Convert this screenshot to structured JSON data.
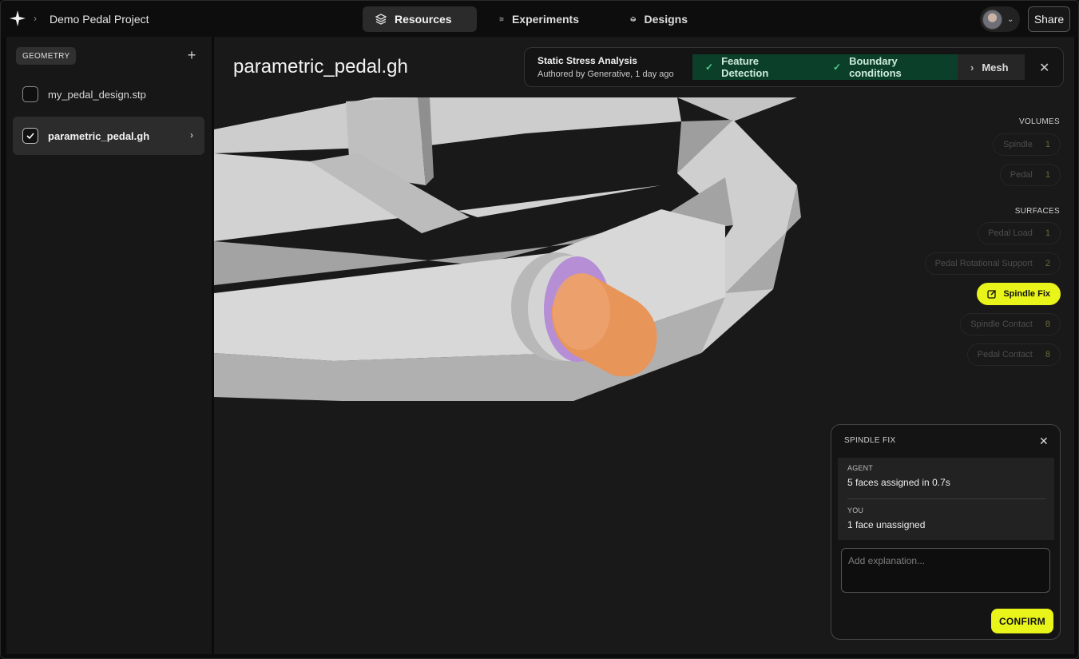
{
  "topbar": {
    "project_name": "Demo Pedal Project",
    "tabs": [
      {
        "label": "Resources",
        "icon": "layers-icon",
        "active": true
      },
      {
        "label": "Experiments",
        "icon": "sliders-icon",
        "active": false
      },
      {
        "label": "Designs",
        "icon": "cube-icon",
        "active": false
      }
    ],
    "share_label": "Share"
  },
  "sidebar": {
    "section_label": "GEOMETRY",
    "files": [
      {
        "name": "my_pedal_design.stp",
        "checked": false
      },
      {
        "name": "parametric_pedal.gh",
        "checked": true
      }
    ]
  },
  "main": {
    "title": "parametric_pedal.gh",
    "analysis": {
      "title": "Static Stress Analysis",
      "subtitle": "Authored by Generative, 1 day ago",
      "steps": [
        {
          "label": "Feature Detection",
          "status": "done"
        },
        {
          "label": "Boundary conditions",
          "status": "done"
        },
        {
          "label": "Mesh",
          "status": "next"
        }
      ]
    },
    "volumes": {
      "label": "VOLUMES",
      "items": [
        {
          "label": "Spindle",
          "count": "1"
        },
        {
          "label": "Pedal",
          "count": "1"
        }
      ]
    },
    "surfaces": {
      "label": "SURFACES",
      "items": [
        {
          "label": "Pedal Load",
          "count": "1"
        },
        {
          "label": "Pedal Rotational Support",
          "count": "2"
        },
        {
          "label": "Spindle Fix",
          "count": ""
        },
        {
          "label": "Spindle Contact",
          "count": "8"
        },
        {
          "label": "Pedal Contact",
          "count": "8"
        }
      ]
    },
    "dialog": {
      "title": "SPINDLE FIX",
      "agent_label": "AGENT",
      "agent_value": "5 faces assigned in 0.7s",
      "you_label": "YOU",
      "you_value": "1 face unassigned",
      "placeholder": "Add explanation...",
      "confirm_label": "CONFIRM"
    }
  },
  "colors": {
    "accent": "#e8f41a",
    "step_done_bg": "#0b3f2a",
    "model_grey": "#cfcfcf",
    "spindle_orange": "#e8955a",
    "face_purple": "#b58ed6"
  }
}
